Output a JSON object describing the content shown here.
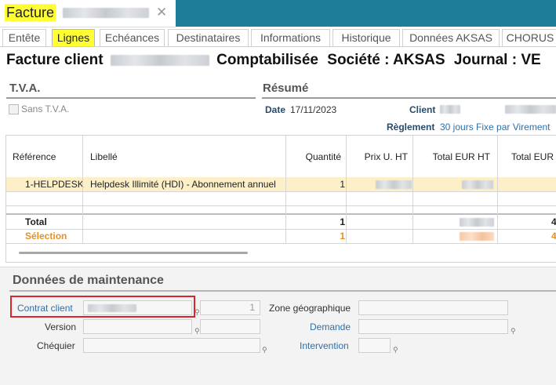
{
  "window": {
    "title": "Facture",
    "close": "✕"
  },
  "tabs": [
    {
      "label": "Entête",
      "active": false
    },
    {
      "label": "Lignes",
      "active": true
    },
    {
      "label": "Echéances",
      "active": false
    },
    {
      "label": "Destinataires",
      "active": false
    },
    {
      "label": "Informations",
      "active": false
    },
    {
      "label": "Historique",
      "active": false
    },
    {
      "label": "Données AKSAS",
      "active": false
    },
    {
      "label": "CHORUS",
      "active": false
    }
  ],
  "header": {
    "prefix": "Facture client",
    "status": "Comptabilisée",
    "societe": "Société : AKSAS",
    "journal": "Journal : VE"
  },
  "tva": {
    "title": "T.V.A.",
    "sans_tva": "Sans T.V.A."
  },
  "resume": {
    "title": "Résumé",
    "date_label": "Date",
    "date_value": "17/11/2023",
    "client_label": "Client",
    "reglement_label": "Règlement",
    "reglement_value": "30 jours Fixe par Virement"
  },
  "grid": {
    "headers": [
      "Référence",
      "Libellé",
      "Quantité",
      "Prix U. HT",
      "Total EUR HT",
      "Total EUR"
    ],
    "row": {
      "ref": "1-HELPDESK",
      "libelle": "Helpdesk Illimité (HDI) - Abonnement annuel",
      "qty": "1"
    },
    "total": {
      "label": "Total",
      "qty": "1",
      "tail": "4"
    },
    "selection": {
      "label": "Sélection",
      "qty": "1",
      "tail": "4"
    }
  },
  "maintenance": {
    "title": "Données de maintenance",
    "contrat_label": "Contrat client",
    "contrat_num": "1",
    "version_label": "Version",
    "chequier_label": "Chéquier",
    "zone_label": "Zone géographique",
    "demande_label": "Demande",
    "intervention_label": "Intervention"
  },
  "colors": {
    "accent": "#1e7d99",
    "highlight": "#ffff33",
    "selection": "#e8901e",
    "row_highlight": "#fdf0c8",
    "annotation": "#d9262c"
  },
  "icons": {
    "close": "close-icon",
    "pin": "pin-icon"
  }
}
